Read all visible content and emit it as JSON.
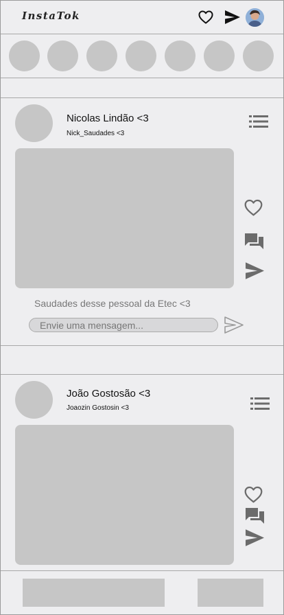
{
  "app": {
    "logo": "InstaTok"
  },
  "header": {
    "icons": [
      "heart-icon",
      "send-icon",
      "profile-avatar"
    ]
  },
  "stories": {
    "count": 7
  },
  "posts": [
    {
      "username": "Nicolas Lindão <3",
      "handle": "Nick_Saudades <3",
      "caption": "Saudades desse pessoal da Etec <3",
      "message_placeholder": "Envie uma mensagem..."
    },
    {
      "username": "João Gostosão <3",
      "handle": "Joaozin Gostosin <3"
    }
  ],
  "colors": {
    "background": "#eeeef0",
    "placeholder": "#c6c6c6",
    "icon_gray": "#6b6b6b",
    "icon_dark": "#111111",
    "divider": "#a8a8a8"
  }
}
